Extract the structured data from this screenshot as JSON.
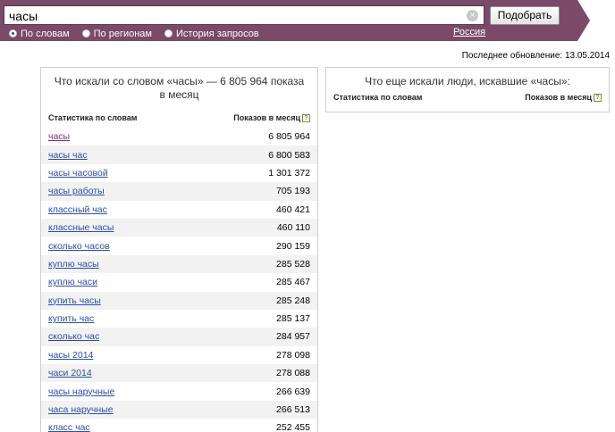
{
  "search": {
    "query": "часы",
    "submit_label": "Подобрать"
  },
  "modes": [
    {
      "label": "По словам",
      "selected": true
    },
    {
      "label": "По регионам",
      "selected": false
    },
    {
      "label": "История запросов",
      "selected": false
    }
  ],
  "region": "Россия",
  "last_update": "Последнее обновление: 13.05.2014",
  "left_panel": {
    "title": "Что искали со словом «часы» — 6 805 964 показа в месяц",
    "col_words": "Статистика по словам",
    "col_counts": "Показов в месяц",
    "rows": [
      {
        "phrase": "часы",
        "count": "6 805 964"
      },
      {
        "phrase": "часы час",
        "count": "6 800 583"
      },
      {
        "phrase": "часы часовой",
        "count": "1 301 372"
      },
      {
        "phrase": "часы работы",
        "count": "705 193"
      },
      {
        "phrase": "классный час",
        "count": "460 421"
      },
      {
        "phrase": "классные часы",
        "count": "460 110"
      },
      {
        "phrase": "сколько часов",
        "count": "290 159"
      },
      {
        "phrase": "куплю часы",
        "count": "285 528"
      },
      {
        "phrase": "куплю часи",
        "count": "285 467"
      },
      {
        "phrase": "купить часы",
        "count": "285 248"
      },
      {
        "phrase": "купить час",
        "count": "285 137"
      },
      {
        "phrase": "сколько час",
        "count": "284 957"
      },
      {
        "phrase": "часы 2014",
        "count": "278 098"
      },
      {
        "phrase": "часи 2014",
        "count": "278 088"
      },
      {
        "phrase": "часы наручные",
        "count": "266 639"
      },
      {
        "phrase": "часа наручные",
        "count": "266 513"
      },
      {
        "phrase": "класс час",
        "count": "252 455"
      }
    ]
  },
  "right_panel": {
    "title": "Что еще искали люди, искавшие «часы»:",
    "col_words": "Статистика по словам",
    "col_counts": "Показов в месяц"
  },
  "colors": {
    "header_bg": "#7a4a68",
    "link": "#2b4ea8",
    "visited_link": "#8a2a8a"
  }
}
